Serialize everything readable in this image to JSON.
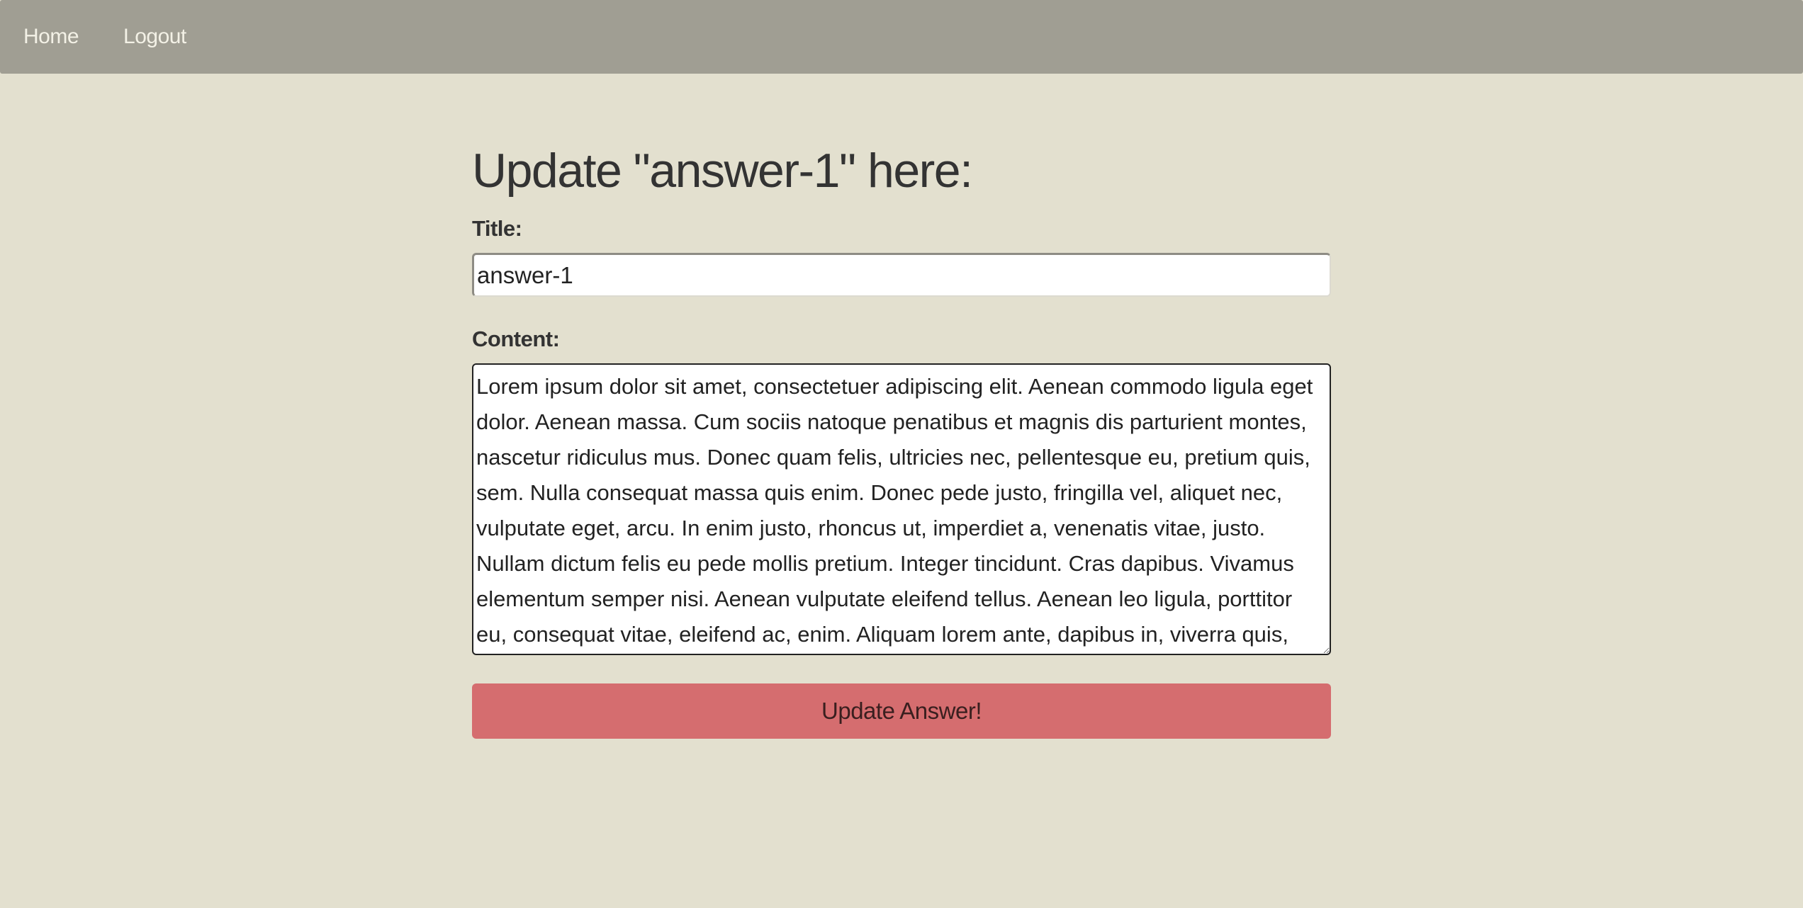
{
  "navbar": {
    "home_label": "Home",
    "logout_label": "Logout"
  },
  "form": {
    "heading": "Update \"answer-1\" here:",
    "title_label": "Title:",
    "title_value": "answer-1",
    "content_label": "Content:",
    "content_value": "Lorem ipsum dolor sit amet, consectetuer adipiscing elit. Aenean commodo ligula eget dolor. Aenean massa. Cum sociis natoque penatibus et magnis dis parturient montes, nascetur ridiculus mus. Donec quam felis, ultricies nec, pellentesque eu, pretium quis, sem. Nulla consequat massa quis enim. Donec pede justo, fringilla vel, aliquet nec, vulputate eget, arcu. In enim justo, rhoncus ut, imperdiet a, venenatis vitae, justo. Nullam dictum felis eu pede mollis pretium. Integer tincidunt. Cras dapibus. Vivamus elementum semper nisi. Aenean vulputate eleifend tellus. Aenean leo ligula, porttitor eu, consequat vitae, eleifend ac, enim. Aliquam lorem ante, dapibus in, viverra quis, feugiat a, tellus. Phasellus viverra nulla ut metus varius laoreet. Quisque",
    "submit_label": "Update Answer!"
  },
  "colors": {
    "page_background": "#e3e0cf",
    "navbar_background": "#a09e93",
    "submit_button": "#d56d6f"
  }
}
